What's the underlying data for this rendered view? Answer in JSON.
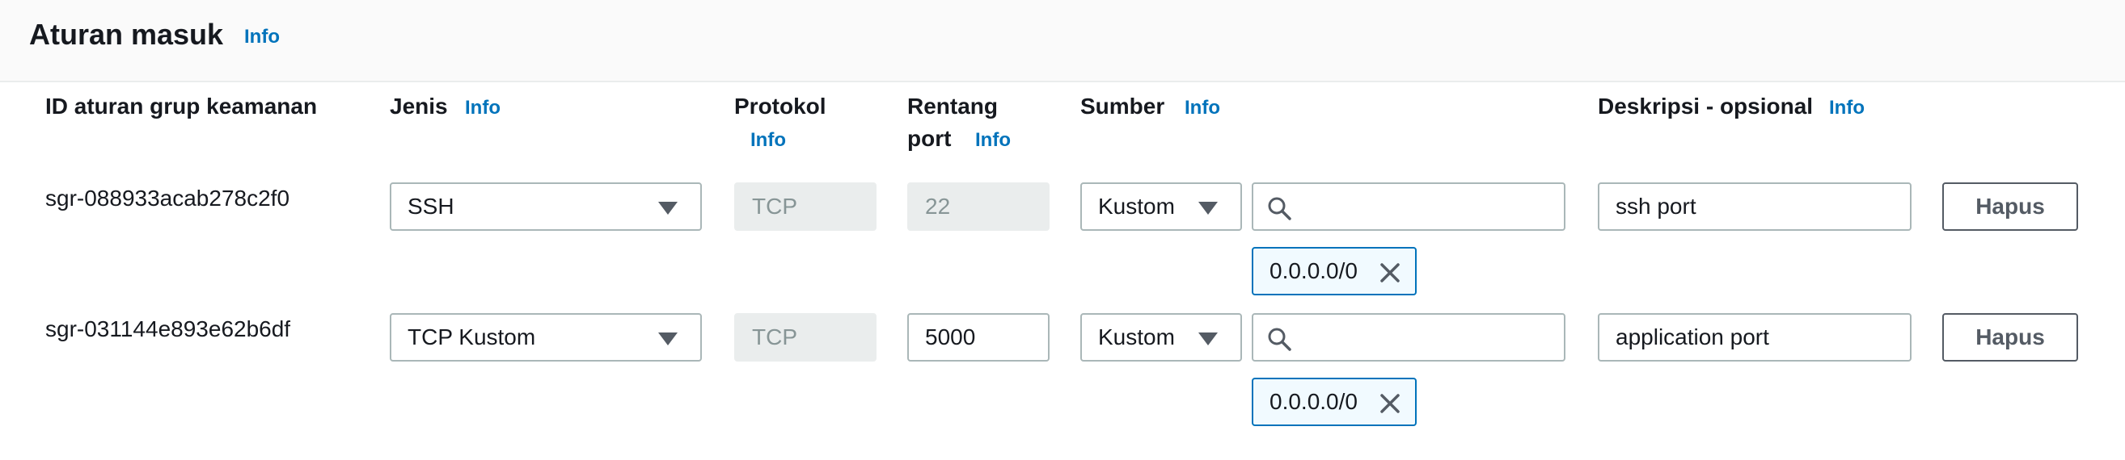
{
  "section": {
    "title": "Aturan masuk",
    "info": "Info"
  },
  "columns": {
    "rule_id": "ID aturan grup keamanan",
    "type": "Jenis",
    "protocol": "Protokol",
    "port_range_line1": "Rentang",
    "port_range_line2": "port",
    "source": "Sumber",
    "description": "Deskripsi - opsional",
    "info": "Info"
  },
  "rules": [
    {
      "id": "sgr-088933acab278c2f0",
      "type": "SSH",
      "protocol": "TCP",
      "port": "22",
      "source_type": "Kustom",
      "source_search_value": "",
      "source_token": "0.0.0.0/0",
      "description": "ssh port",
      "delete_label": "Hapus"
    },
    {
      "id": "sgr-031144e893e62b6df",
      "type": "TCP Kustom",
      "protocol": "TCP",
      "port": "5000",
      "source_type": "Kustom",
      "source_search_value": "",
      "source_token": "0.0.0.0/0",
      "description": "application port",
      "delete_label": "Hapus"
    }
  ]
}
